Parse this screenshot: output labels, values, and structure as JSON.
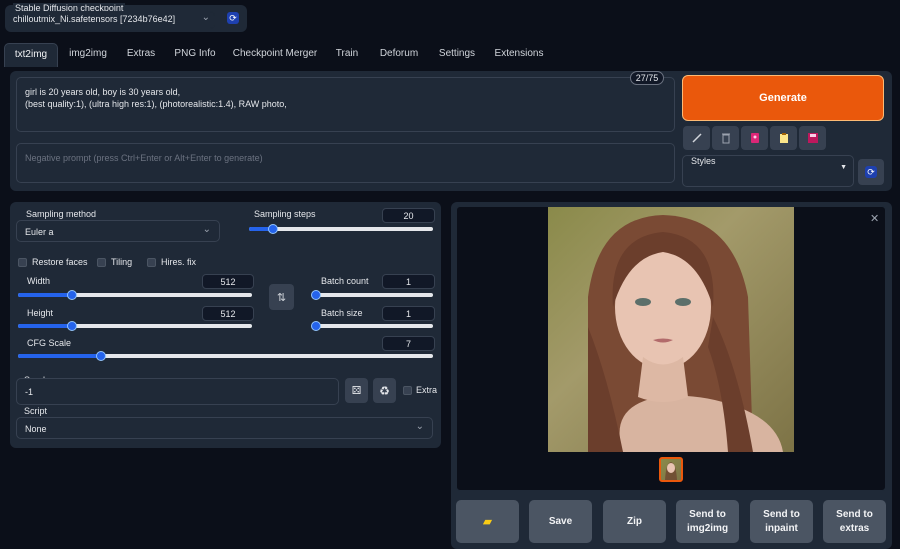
{
  "checkpoint": {
    "label": "Stable Diffusion checkpoint",
    "value": "chilloutmix_Ni.safetensors [7234b76e42]"
  },
  "tabs": [
    "txt2img",
    "img2img",
    "Extras",
    "PNG Info",
    "Checkpoint Merger",
    "Train",
    "Deforum",
    "Settings",
    "Extensions"
  ],
  "prompt": {
    "line1": "girl is 20 years old, boy is 30 years old,",
    "line2": "(best quality:1), (ultra high res:1), (photorealistic:1.4), RAW photo,",
    "token_count": "27/75",
    "negative_placeholder": "Negative prompt (press Ctrl+Enter or Alt+Enter to generate)"
  },
  "generate_label": "Generate",
  "styles_label": "Styles",
  "sampling": {
    "method_label": "Sampling method",
    "method_value": "Euler a",
    "steps_label": "Sampling steps",
    "steps": "20",
    "steps_fraction": 0.13
  },
  "checkboxes": {
    "restore_faces": "Restore faces",
    "tiling": "Tiling",
    "hires_fix": "Hires. fix"
  },
  "width": {
    "label": "Width",
    "value": "512",
    "fraction": 0.23
  },
  "height": {
    "label": "Height",
    "value": "512",
    "fraction": 0.23
  },
  "batch_count": {
    "label": "Batch count",
    "value": "1",
    "fraction": 0.0
  },
  "batch_size": {
    "label": "Batch size",
    "value": "1",
    "fraction": 0.0
  },
  "cfg": {
    "label": "CFG Scale",
    "value": "7",
    "fraction": 0.2
  },
  "seed": {
    "label": "Seed",
    "value": "-1",
    "extra_label": "Extra"
  },
  "script": {
    "label": "Script",
    "value": "None"
  },
  "output_buttons": {
    "folder": "",
    "save": "Save",
    "zip": "Zip",
    "send_img2img": "Send to img2img",
    "send_inpaint": "Send to inpaint",
    "send_extras": "Send to extras"
  },
  "colors": {
    "accent": "#ea580c",
    "slider": "#2563eb",
    "panel": "#1f2937",
    "background": "#0b0f19"
  },
  "icons": [
    "refresh-icon",
    "paint-brush-icon",
    "trash-icon",
    "pink-card-icon",
    "clipboard-icon",
    "save-disk-icon",
    "swap-icon",
    "dice-icon",
    "recycle-icon",
    "folder-icon",
    "close-icon"
  ]
}
